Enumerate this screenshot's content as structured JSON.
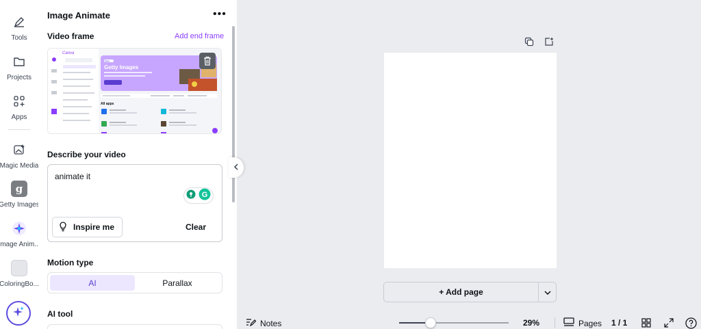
{
  "rail": {
    "items": [
      {
        "label": "Tools",
        "icon": "pen-icon"
      },
      {
        "label": "Projects",
        "icon": "folder-icon"
      },
      {
        "label": "Apps",
        "icon": "apps-grid-icon"
      },
      {
        "label": "Magic Media",
        "icon": "magic-media-icon"
      },
      {
        "label": "Getty Images",
        "icon": "getty-g-icon"
      },
      {
        "label": "Image Anim...",
        "icon": "image-animate-icon"
      },
      {
        "label": "ColoringBo...",
        "icon": "coloringbook-icon"
      }
    ],
    "magic_button_icon": "sparkle-icon"
  },
  "panel": {
    "title": "Image Animate",
    "video_frame_label": "Video frame",
    "add_end_frame": "Add end frame",
    "frame_thumb": {
      "logo": "Canva",
      "banner_tag": "New",
      "banner_title": "Getty Images",
      "section": "All apps"
    },
    "describe_label": "Describe your video",
    "description_value": "animate it",
    "inspire_label": "Inspire me",
    "clear_label": "Clear",
    "motion_label": "Motion type",
    "motion_options": [
      "AI",
      "Parallax"
    ],
    "motion_selected": "AI",
    "ai_tool_label": "AI tool"
  },
  "canvas": {
    "add_page_label": "+ Add page"
  },
  "footer": {
    "notes_label": "Notes",
    "zoom_percent": 29,
    "zoom_label": "29%",
    "pages_label": "Pages",
    "page_count": "1 / 1"
  },
  "colors": {
    "accent": "#8b3dff",
    "canvas_bg": "#ebecf0",
    "active_segment": "#ece7ff"
  }
}
